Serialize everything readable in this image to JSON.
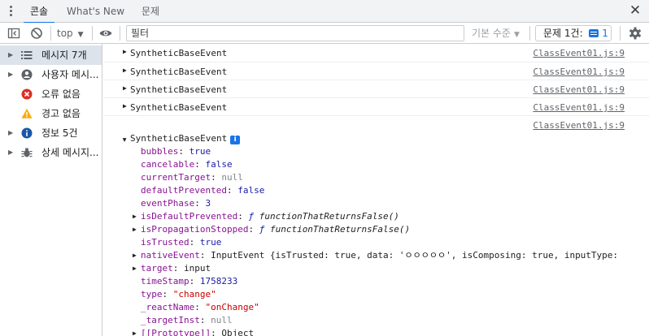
{
  "tabs": [
    {
      "label": "콘솔",
      "active": true
    },
    {
      "label": "What's New",
      "active": false
    },
    {
      "label": "문제",
      "active": false
    }
  ],
  "toolbar": {
    "context": "top",
    "filter_placeholder": "필터",
    "levels_label": "기본 수준",
    "issues_label": "문제 1건:",
    "issues_count": "1"
  },
  "sidebar": {
    "items": [
      {
        "label": "메시지 7개",
        "icon": "list-icon",
        "expandable": true,
        "selected": true
      },
      {
        "label": "사용자 메시...",
        "icon": "user-icon",
        "expandable": true,
        "selected": false
      },
      {
        "label": "오류 없음",
        "icon": "error-icon",
        "expandable": false,
        "selected": false
      },
      {
        "label": "경고 없음",
        "icon": "warning-icon",
        "expandable": false,
        "selected": false
      },
      {
        "label": "정보 5건",
        "icon": "info-icon",
        "expandable": true,
        "selected": false
      },
      {
        "label": "상세 메시지...",
        "icon": "bug-icon",
        "expandable": true,
        "selected": false
      }
    ]
  },
  "console": {
    "rows": [
      {
        "text": "SyntheticBaseEvent",
        "source": "ClassEvent01.js:9"
      },
      {
        "text": "SyntheticBaseEvent",
        "source": "ClassEvent01.js:9"
      },
      {
        "text": "SyntheticBaseEvent",
        "source": "ClassEvent01.js:9"
      },
      {
        "text": "SyntheticBaseEvent",
        "source": "ClassEvent01.js:9"
      }
    ],
    "expanded": {
      "text": "SyntheticBaseEvent",
      "source": "ClassEvent01.js:9",
      "props": [
        {
          "key": "bubbles",
          "value": "true",
          "type": "bool"
        },
        {
          "key": "cancelable",
          "value": "false",
          "type": "bool"
        },
        {
          "key": "currentTarget",
          "value": "null",
          "type": "null"
        },
        {
          "key": "defaultPrevented",
          "value": "false",
          "type": "bool"
        },
        {
          "key": "eventPhase",
          "value": "3",
          "type": "num"
        },
        {
          "key": "isDefaultPrevented",
          "value": "functionThatReturnsFalse()",
          "type": "fn",
          "expandable": true
        },
        {
          "key": "isPropagationStopped",
          "value": "functionThatReturnsFalse()",
          "type": "fn",
          "expandable": true
        },
        {
          "key": "isTrusted",
          "value": "true",
          "type": "bool"
        },
        {
          "key": "nativeEvent",
          "value": "InputEvent {isTrusted: true, data: 'ㅇㅇㅇㅇㅇ', isComposing: true, inputType:",
          "type": "obj",
          "expandable": true
        },
        {
          "key": "target",
          "value": "input",
          "type": "plain",
          "expandable": true
        },
        {
          "key": "timeStamp",
          "value": "1758233",
          "type": "num"
        },
        {
          "key": "type",
          "value": "\"change\"",
          "type": "str"
        },
        {
          "key": "_reactName",
          "value": "\"onChange\"",
          "type": "str"
        },
        {
          "key": "_targetInst",
          "value": "null",
          "type": "null"
        },
        {
          "key": "[[Prototype]]",
          "value": "Object",
          "type": "plain",
          "expandable": true
        }
      ]
    }
  },
  "colors": {
    "accent": "#1a73e8",
    "error": "#d93025",
    "warning": "#f9ab00",
    "key": "#881391",
    "string": "#c80000",
    "number": "#1a1aa6"
  }
}
